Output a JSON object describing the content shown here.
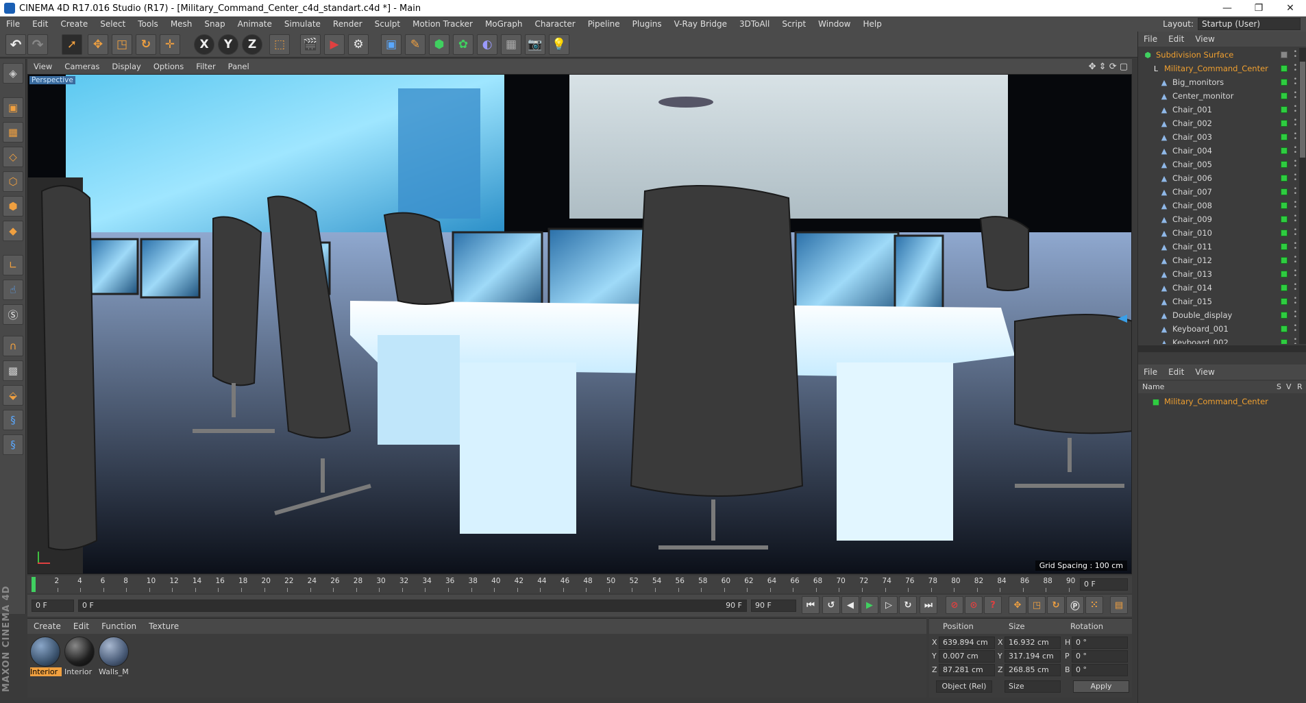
{
  "window": {
    "title": "CINEMA 4D R17.016 Studio (R17) - [Military_Command_Center_c4d_standart.c4d *] - Main",
    "minimize": "—",
    "maximize": "❐",
    "close": "✕"
  },
  "menubar": {
    "items": [
      "File",
      "Edit",
      "Create",
      "Select",
      "Tools",
      "Mesh",
      "Snap",
      "Animate",
      "Simulate",
      "Render",
      "Sculpt",
      "Motion Tracker",
      "MoGraph",
      "Character",
      "Pipeline",
      "Plugins",
      "V-Ray Bridge",
      "3DToAll",
      "Script",
      "Window",
      "Help"
    ],
    "layout_label": "Layout:",
    "layout_value": "Startup (User)"
  },
  "toolbar": {
    "icons": [
      "undo-icon",
      "redo-icon",
      "live-select-icon",
      "move-icon",
      "scale-icon",
      "rotate-icon",
      "transform-icon",
      "x-axis-icon",
      "y-axis-icon",
      "z-axis-icon",
      "coordinate-system-icon",
      "render-view-icon",
      "render-picture-viewer-icon",
      "edit-render-settings-icon",
      "cube-icon",
      "pen-icon",
      "subdivision-surface-icon",
      "array-icon",
      "deformer-icon",
      "floor-icon",
      "camera-icon",
      "light-icon"
    ],
    "x": "X",
    "y": "Y",
    "z": "Z"
  },
  "viewport": {
    "menu": [
      "View",
      "Cameras",
      "Display",
      "Options",
      "Filter",
      "Panel"
    ],
    "label": "Perspective",
    "grid_spacing": "Grid Spacing : 100 cm"
  },
  "timeline": {
    "ticks": [
      "0",
      "2",
      "4",
      "6",
      "8",
      "10",
      "12",
      "14",
      "16",
      "18",
      "20",
      "22",
      "24",
      "26",
      "28",
      "30",
      "32",
      "34",
      "36",
      "38",
      "40",
      "42",
      "44",
      "46",
      "48",
      "50",
      "52",
      "54",
      "56",
      "58",
      "60",
      "62",
      "64",
      "66",
      "68",
      "70",
      "72",
      "74",
      "76",
      "78",
      "80",
      "82",
      "84",
      "86",
      "88",
      "90"
    ],
    "current_frame": "0 F",
    "start_field": "0 F",
    "range_start": "0 F",
    "range_end": "90 F",
    "end_field": "90 F"
  },
  "material_manager": {
    "menu": [
      "Create",
      "Edit",
      "Function",
      "Texture"
    ],
    "materials": [
      {
        "name": "Interior",
        "color": "#3d5570"
      },
      {
        "name": "Interior",
        "color": "#1e1e1e"
      },
      {
        "name": "Walls_M",
        "color": "#4a5c78"
      }
    ]
  },
  "coordinates": {
    "headers": [
      "Position",
      "Size",
      "Rotation"
    ],
    "rows": [
      {
        "axis": "X",
        "pos": "639.894 cm",
        "size_axis": "X",
        "size": "16.932 cm",
        "rot_axis": "H",
        "rot": "0 °"
      },
      {
        "axis": "Y",
        "pos": "0.007 cm",
        "size_axis": "Y",
        "size": "317.194 cm",
        "rot_axis": "P",
        "rot": "0 °"
      },
      {
        "axis": "Z",
        "pos": "87.281 cm",
        "size_axis": "Z",
        "size": "268.85 cm",
        "rot_axis": "B",
        "rot": "0 °"
      }
    ],
    "mode": "Object (Rel)",
    "size_mode": "Size",
    "apply": "Apply"
  },
  "object_manager": {
    "menu": [
      "File",
      "Edit",
      "View"
    ],
    "objects": [
      {
        "name": "Subdivision Surface",
        "level": 0,
        "highlight": true
      },
      {
        "name": "Military_Command_Center",
        "level": 1,
        "highlight": true
      },
      {
        "name": "Big_monitors",
        "level": 2
      },
      {
        "name": "Center_monitor",
        "level": 2
      },
      {
        "name": "Chair_001",
        "level": 2
      },
      {
        "name": "Chair_002",
        "level": 2
      },
      {
        "name": "Chair_003",
        "level": 2
      },
      {
        "name": "Chair_004",
        "level": 2
      },
      {
        "name": "Chair_005",
        "level": 2
      },
      {
        "name": "Chair_006",
        "level": 2
      },
      {
        "name": "Chair_007",
        "level": 2
      },
      {
        "name": "Chair_008",
        "level": 2
      },
      {
        "name": "Chair_009",
        "level": 2
      },
      {
        "name": "Chair_010",
        "level": 2
      },
      {
        "name": "Chair_011",
        "level": 2
      },
      {
        "name": "Chair_012",
        "level": 2
      },
      {
        "name": "Chair_013",
        "level": 2
      },
      {
        "name": "Chair_014",
        "level": 2
      },
      {
        "name": "Chair_015",
        "level": 2
      },
      {
        "name": "Double_display",
        "level": 2
      },
      {
        "name": "Keyboard_001",
        "level": 2
      },
      {
        "name": "Keyboard_002",
        "level": 2
      }
    ]
  },
  "layer_manager": {
    "menu": [
      "File",
      "Edit",
      "View"
    ],
    "col_name": "Name",
    "col_s": "S",
    "col_v": "V",
    "col_r": "R",
    "row": "Military_Command_Center"
  },
  "branding": {
    "text": "MAXON CINEMA 4D"
  },
  "colors": {
    "accent_orange": "#f0a040",
    "green_flag": "#2ecc40",
    "highlight_text": "#f0a030"
  }
}
